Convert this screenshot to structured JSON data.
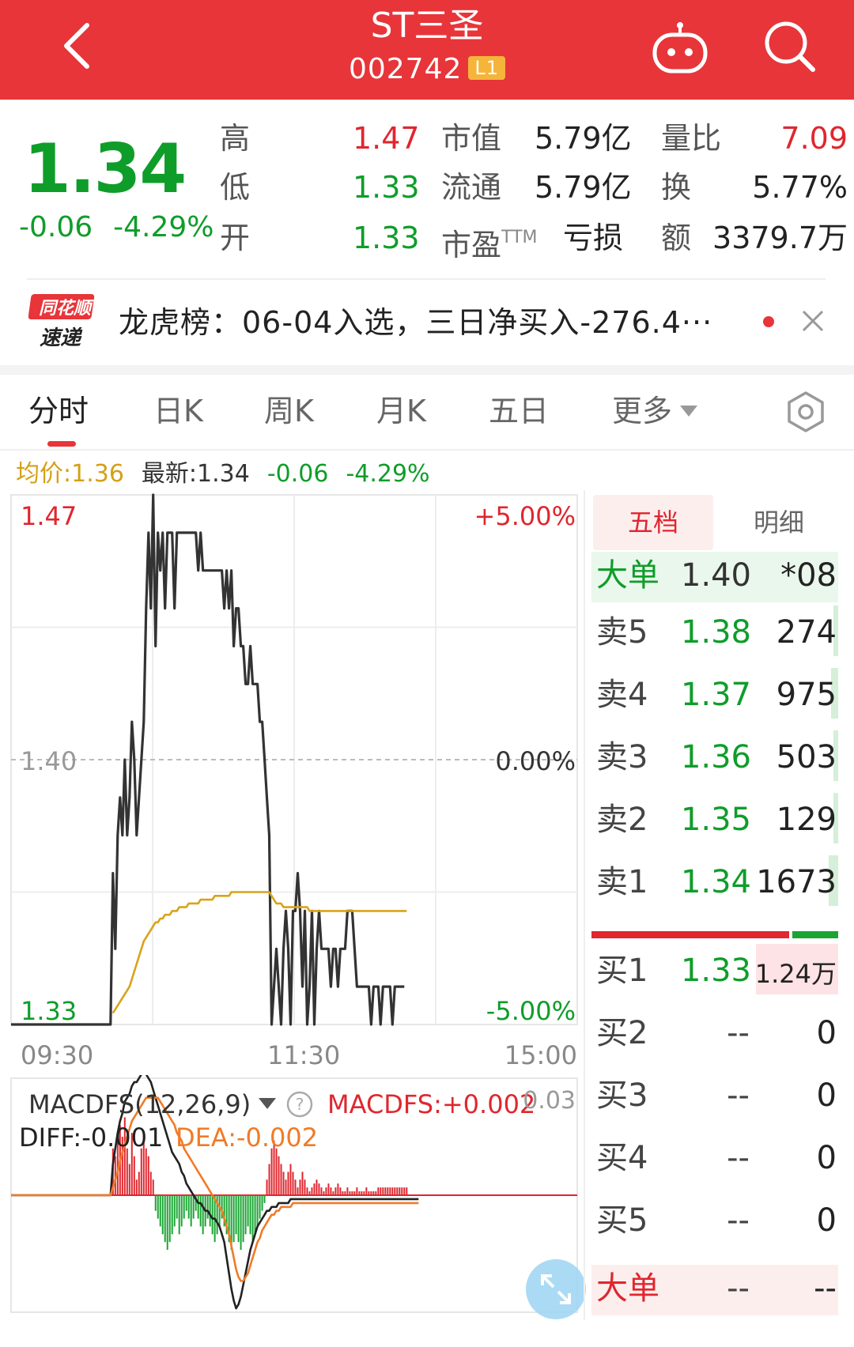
{
  "header": {
    "title": "ST三圣",
    "code": "002742",
    "level_badge": "L1"
  },
  "quote": {
    "price": "1.34",
    "change": "-0.06",
    "change_pct": "-4.29%",
    "stats": [
      {
        "label": "高",
        "value": "1.47",
        "color": "#e0262e"
      },
      {
        "label": "低",
        "value": "1.33",
        "color": "#0f9d2a"
      },
      {
        "label": "开",
        "value": "1.33",
        "color": "#0f9d2a"
      },
      {
        "label": "市值",
        "value": "5.79亿"
      },
      {
        "label": "流通",
        "value": "5.79亿"
      },
      {
        "label": "市盈",
        "label_sup": "TTM",
        "value": "亏损"
      },
      {
        "label": "量比",
        "value": "7.09",
        "color": "#e0262e"
      },
      {
        "label": "换",
        "value": "5.77%"
      },
      {
        "label": "额",
        "value": "3379.7万"
      }
    ]
  },
  "news": {
    "logo_top": "同花顺",
    "logo_bottom": "速递",
    "text": "龙虎榜：06-04入选，三日净买入-276.4···"
  },
  "tabs": [
    {
      "label": "分时",
      "active": true
    },
    {
      "label": "日K"
    },
    {
      "label": "周K"
    },
    {
      "label": "月K"
    },
    {
      "label": "五日"
    },
    {
      "label": "更多"
    }
  ],
  "info_line": {
    "avg": "均价:1.36",
    "latest": "最新:1.34",
    "change": "-0.06",
    "change_pct": "-4.29%"
  },
  "chart_data": [
    {
      "type": "line",
      "y_left_labels": [
        "1.47",
        "1.40",
        "1.33"
      ],
      "y_right_labels": [
        "+5.00%",
        "0.00%",
        "-5.00%"
      ],
      "x_tick_labels": [
        "09:30",
        "11:30",
        "15:00"
      ],
      "ylim": [
        1.33,
        1.47
      ],
      "base_price": 1.4,
      "grid": true,
      "series": [
        {
          "role": "price",
          "color": "#333333",
          "values": [
            1.33,
            1.33,
            1.33,
            1.33,
            1.33,
            1.33,
            1.33,
            1.33,
            1.33,
            1.33,
            1.33,
            1.33,
            1.33,
            1.33,
            1.33,
            1.33,
            1.33,
            1.33,
            1.33,
            1.33,
            1.33,
            1.33,
            1.33,
            1.33,
            1.33,
            1.33,
            1.33,
            1.33,
            1.33,
            1.33,
            1.33,
            1.33,
            1.33,
            1.33,
            1.33,
            1.33,
            1.33,
            1.33,
            1.33,
            1.33,
            1.33,
            1.33,
            1.33,
            1.37,
            1.35,
            1.38,
            1.39,
            1.38,
            1.4,
            1.38,
            1.39,
            1.41,
            1.4,
            1.38,
            1.39,
            1.4,
            1.41,
            1.44,
            1.46,
            1.44,
            1.47,
            1.43,
            1.46,
            1.45,
            1.46,
            1.44,
            1.46,
            1.46,
            1.46,
            1.44,
            1.46,
            1.46,
            1.46,
            1.46,
            1.46,
            1.46,
            1.46,
            1.46,
            1.46,
            1.45,
            1.46,
            1.45,
            1.45,
            1.45,
            1.45,
            1.45,
            1.45,
            1.45,
            1.45,
            1.45,
            1.44,
            1.45,
            1.44,
            1.45,
            1.43,
            1.44,
            1.44,
            1.43,
            1.43,
            1.42,
            1.42,
            1.43,
            1.42,
            1.42,
            1.42,
            1.41,
            1.41,
            1.4,
            1.39,
            1.38,
            1.33,
            1.34,
            1.35,
            1.34,
            1.33,
            1.35,
            1.36,
            1.35,
            1.33,
            1.36,
            1.36,
            1.37,
            1.36,
            1.34,
            1.36,
            1.33,
            1.34,
            1.36,
            1.33,
            1.35,
            1.36,
            1.35,
            1.35,
            1.35,
            1.35,
            1.34,
            1.35,
            1.35,
            1.34,
            1.35,
            1.35,
            1.35,
            1.36,
            1.36,
            1.36,
            1.35,
            1.34,
            1.34,
            1.34,
            1.34,
            1.34,
            1.34,
            1.33,
            1.34,
            1.34,
            1.34,
            1.33,
            1.34,
            1.34,
            1.34,
            1.34,
            1.33,
            1.34,
            1.34,
            1.34,
            1.34,
            1.34
          ]
        },
        {
          "role": "average",
          "color": "#d9a31a",
          "values": [
            null,
            null,
            null,
            null,
            null,
            null,
            null,
            null,
            null,
            null,
            null,
            null,
            null,
            null,
            null,
            null,
            null,
            null,
            null,
            null,
            null,
            null,
            null,
            null,
            null,
            null,
            null,
            null,
            null,
            null,
            null,
            null,
            null,
            null,
            null,
            null,
            null,
            null,
            null,
            null,
            null,
            null,
            null,
            1.333,
            1.334,
            1.335,
            1.336,
            1.337,
            1.338,
            1.339,
            1.34,
            1.342,
            1.344,
            1.346,
            1.348,
            1.35,
            1.352,
            1.353,
            1.354,
            1.355,
            1.356,
            1.357,
            1.357,
            1.358,
            1.358,
            1.359,
            1.359,
            1.359,
            1.36,
            1.36,
            1.36,
            1.361,
            1.361,
            1.361,
            1.361,
            1.362,
            1.362,
            1.362,
            1.362,
            1.362,
            1.363,
            1.363,
            1.363,
            1.363,
            1.363,
            1.363,
            1.364,
            1.364,
            1.364,
            1.364,
            1.364,
            1.364,
            1.364,
            1.365,
            1.365,
            1.365,
            1.365,
            1.365,
            1.365,
            1.365,
            1.365,
            1.365,
            1.365,
            1.365,
            1.365,
            1.365,
            1.365,
            1.365,
            1.365,
            1.365,
            1.364,
            1.363,
            1.362,
            1.362,
            1.362,
            1.361,
            1.361,
            1.361,
            1.361,
            1.361,
            1.361,
            1.361,
            1.361,
            1.361,
            1.361,
            1.361,
            1.36,
            1.36,
            1.36,
            1.36,
            1.36,
            1.36,
            1.36,
            1.36,
            1.36,
            1.36,
            1.36,
            1.36,
            1.36,
            1.36,
            1.36,
            1.36,
            1.36,
            1.36,
            1.36,
            1.36,
            1.36,
            1.36,
            1.36,
            1.36,
            1.36,
            1.36,
            1.36,
            1.36,
            1.36,
            1.36,
            1.36,
            1.36,
            1.36,
            1.36,
            1.36,
            1.36,
            1.36,
            1.36,
            1.36,
            1.36,
            1.36,
            1.36
          ]
        }
      ]
    },
    {
      "type": "bar",
      "indicator_label": "MACDFS(12,26,9)",
      "value_label": "MACDFS:+0.002",
      "diff_label": "DIFF:-0.001",
      "dea_label": "DEA:-0.002",
      "y_right_label": "0.03",
      "ylim": [
        -0.03,
        0.03
      ],
      "series": [
        {
          "name": "MACDFS",
          "role": "histogram",
          "values": [
            0,
            0,
            0,
            0,
            0,
            0,
            0,
            0,
            0,
            0,
            0,
            0,
            0,
            0,
            0,
            0,
            0,
            0,
            0,
            0,
            0,
            0,
            0,
            0,
            0,
            0,
            0,
            0,
            0,
            0,
            0,
            0,
            0,
            0,
            0,
            0,
            0,
            0,
            0,
            0,
            0,
            0,
            0,
            0.012,
            0.01,
            0.016,
            0.018,
            0.015,
            0.02,
            0.012,
            0.008,
            0.016,
            0.01,
            0.004,
            0.006,
            0.012,
            0.016,
            0.012,
            0.01,
            0.006,
            0.004,
            -0.004,
            -0.006,
            -0.008,
            -0.01,
            -0.012,
            -0.014,
            -0.012,
            -0.01,
            -0.008,
            -0.006,
            -0.01,
            -0.008,
            -0.006,
            -0.004,
            -0.006,
            -0.008,
            -0.006,
            -0.004,
            -0.006,
            -0.008,
            -0.01,
            -0.008,
            -0.006,
            -0.008,
            -0.01,
            -0.012,
            -0.01,
            -0.008,
            -0.006,
            -0.008,
            -0.01,
            -0.012,
            -0.014,
            -0.012,
            -0.01,
            -0.012,
            -0.014,
            -0.012,
            -0.01,
            -0.008,
            -0.01,
            -0.012,
            -0.01,
            -0.008,
            -0.006,
            -0.004,
            -0.002,
            0.004,
            0.008,
            0.012,
            0.014,
            0.012,
            0.01,
            0.008,
            0.006,
            0.004,
            0.006,
            0.008,
            0.006,
            0.004,
            0.002,
            0.004,
            0.006,
            0.004,
            0.002,
            0.001,
            0.002,
            0.003,
            0.004,
            0.003,
            0.002,
            0.001,
            0.002,
            0.003,
            0.002,
            0.001,
            0.002,
            0.003,
            0.002,
            0.001,
            0.001,
            0.002,
            0.001,
            0.001,
            0.001,
            0.002,
            0.001,
            0.001,
            0.001,
            0.002,
            0.001,
            0.001,
            0.001,
            0.001,
            0.002,
            0.002,
            0.002,
            0.002,
            0.002,
            0.002,
            0.002,
            0.002,
            0.002,
            0.002,
            0.002,
            0.002,
            0.002
          ]
        },
        {
          "name": "DIFF",
          "color": "#222222",
          "values": [
            0,
            0,
            0,
            0,
            0,
            0,
            0,
            0,
            0,
            0,
            0,
            0,
            0,
            0,
            0,
            0,
            0,
            0,
            0,
            0,
            0,
            0,
            0,
            0,
            0,
            0,
            0,
            0,
            0,
            0,
            0,
            0,
            0,
            0,
            0,
            0,
            0,
            0,
            0,
            0,
            0,
            0,
            0,
            0.008,
            0.012,
            0.016,
            0.019,
            0.021,
            0.024,
            0.025,
            0.026,
            0.028,
            0.029,
            0.029,
            0.03,
            0.031,
            0.032,
            0.031,
            0.03,
            0.029,
            0.027,
            0.025,
            0.023,
            0.021,
            0.019,
            0.017,
            0.015,
            0.013,
            0.011,
            0.01,
            0.009,
            0.008,
            0.006,
            0.005,
            0.003,
            0.002,
            0.001,
            0.0,
            -0.001,
            -0.002,
            -0.002,
            -0.003,
            -0.004,
            -0.004,
            -0.005,
            -0.006,
            -0.006,
            -0.007,
            -0.008,
            -0.01,
            -0.012,
            -0.016,
            -0.02,
            -0.024,
            -0.027,
            -0.029,
            -0.028,
            -0.026,
            -0.023,
            -0.02,
            -0.017,
            -0.014,
            -0.012,
            -0.01,
            -0.008,
            -0.007,
            -0.006,
            -0.005,
            -0.004,
            -0.004,
            -0.003,
            -0.003,
            -0.003,
            -0.002,
            -0.002,
            -0.002,
            -0.002,
            -0.002,
            -0.001,
            -0.001,
            -0.001,
            -0.001,
            -0.001,
            -0.001,
            -0.001,
            -0.001,
            -0.001,
            -0.001,
            -0.001,
            -0.001,
            -0.001,
            -0.001,
            -0.001,
            -0.001,
            -0.001,
            -0.001,
            -0.001,
            -0.001,
            -0.001,
            -0.001,
            -0.001,
            -0.001,
            -0.001,
            -0.001,
            -0.001,
            -0.001,
            -0.001,
            -0.001,
            -0.001,
            -0.001,
            -0.001,
            -0.001,
            -0.001,
            -0.001,
            -0.001,
            -0.001,
            -0.001,
            -0.001,
            -0.001,
            -0.001,
            -0.001,
            -0.001,
            -0.001,
            -0.001,
            -0.001,
            -0.001,
            -0.001,
            -0.001,
            -0.001,
            -0.001,
            -0.001,
            -0.001,
            -0.001
          ]
        },
        {
          "name": "DEA",
          "color": "#f07b27",
          "values": [
            0,
            0,
            0,
            0,
            0,
            0,
            0,
            0,
            0,
            0,
            0,
            0,
            0,
            0,
            0,
            0,
            0,
            0,
            0,
            0,
            0,
            0,
            0,
            0,
            0,
            0,
            0,
            0,
            0,
            0,
            0,
            0,
            0,
            0,
            0,
            0,
            0,
            0,
            0,
            0,
            0,
            0,
            0,
            0.002,
            0.004,
            0.006,
            0.009,
            0.011,
            0.013,
            0.015,
            0.017,
            0.019,
            0.02,
            0.021,
            0.022,
            0.023,
            0.024,
            0.025,
            0.025,
            0.025,
            0.025,
            0.025,
            0.025,
            0.024,
            0.023,
            0.022,
            0.021,
            0.02,
            0.019,
            0.018,
            0.016,
            0.015,
            0.014,
            0.012,
            0.011,
            0.01,
            0.009,
            0.008,
            0.007,
            0.006,
            0.005,
            0.004,
            0.003,
            0.002,
            0.001,
            0.0,
            -0.001,
            -0.002,
            -0.003,
            -0.004,
            -0.006,
            -0.008,
            -0.01,
            -0.013,
            -0.016,
            -0.019,
            -0.021,
            -0.022,
            -0.022,
            -0.021,
            -0.02,
            -0.018,
            -0.016,
            -0.014,
            -0.012,
            -0.011,
            -0.009,
            -0.008,
            -0.007,
            -0.006,
            -0.005,
            -0.005,
            -0.004,
            -0.004,
            -0.003,
            -0.003,
            -0.003,
            -0.003,
            -0.003,
            -0.002,
            -0.002,
            -0.002,
            -0.002,
            -0.002,
            -0.002,
            -0.002,
            -0.002,
            -0.002,
            -0.002,
            -0.002,
            -0.002,
            -0.002,
            -0.002,
            -0.002,
            -0.002,
            -0.002,
            -0.002,
            -0.002,
            -0.002,
            -0.002,
            -0.002,
            -0.002,
            -0.002,
            -0.002,
            -0.002,
            -0.002,
            -0.002,
            -0.002,
            -0.002,
            -0.002,
            -0.002,
            -0.002,
            -0.002,
            -0.002,
            -0.002,
            -0.002,
            -0.002,
            -0.002,
            -0.002,
            -0.002,
            -0.002,
            -0.002,
            -0.002,
            -0.002,
            -0.002,
            -0.002,
            -0.002,
            -0.002,
            -0.002,
            -0.002,
            -0.002,
            -0.002,
            -0.002
          ]
        }
      ]
    }
  ],
  "order_book": {
    "tabs": [
      "五档",
      "明细"
    ],
    "big_order_top": {
      "label": "大单",
      "price": "1.40",
      "volume": "*08"
    },
    "asks": [
      {
        "label": "卖5",
        "price": "1.38",
        "volume": "274",
        "bar": 0.02
      },
      {
        "label": "卖4",
        "price": "1.37",
        "volume": "975",
        "bar": 0.03
      },
      {
        "label": "卖3",
        "price": "1.36",
        "volume": "503",
        "bar": 0.02
      },
      {
        "label": "卖2",
        "price": "1.35",
        "volume": "129",
        "bar": 0.01
      },
      {
        "label": "卖1",
        "price": "1.34",
        "volume": "1673",
        "bar": 0.04
      }
    ],
    "buy_ratio": 0.8,
    "bids": [
      {
        "label": "买1",
        "price": "1.33",
        "volume": "1.24万",
        "bar": 1.0
      },
      {
        "label": "买2",
        "price": "--",
        "volume": "0"
      },
      {
        "label": "买3",
        "price": "--",
        "volume": "0"
      },
      {
        "label": "买4",
        "price": "--",
        "volume": "0"
      },
      {
        "label": "买5",
        "price": "--",
        "volume": "0"
      }
    ],
    "big_order_bottom": {
      "label": "大单",
      "price": "--",
      "volume": "--"
    }
  },
  "colors": {
    "header": "#e7353a",
    "up": "#e0262e",
    "down": "#0f9d2a",
    "average": "#d9a31a"
  }
}
